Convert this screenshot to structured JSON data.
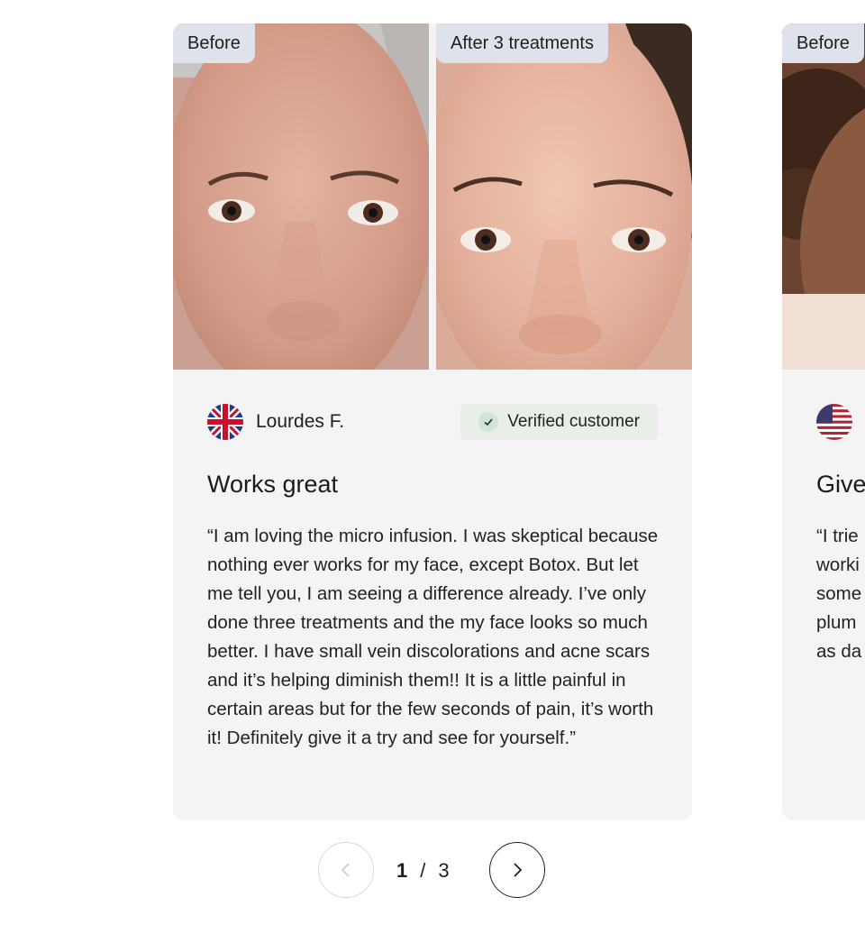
{
  "reviews": [
    {
      "before_label": "Before",
      "after_label": "After 3 treatments",
      "reviewer": "Lourdes F.",
      "country_flag": "uk-flag-icon",
      "verified_label": "Verified customer",
      "title": "Works great",
      "text": "“I am loving the micro infusion. I was skeptical because nothing ever works for my face, except Botox. But let me tell you, I am seeing a difference already. I’ve only done three treatments and the my face looks so much better. I have small vein discolorations and acne scars and it’s helping diminish them!! It is a little painful in certain areas but for the few seconds of pain, it’s worth it! Definitely give it a try and see for yourself.”"
    },
    {
      "before_label": "Before",
      "country_flag": "us-flag-icon",
      "title": "Give",
      "text_lines": [
        "“I trie",
        "worki",
        "some",
        "plum",
        "as da"
      ]
    }
  ],
  "pagination": {
    "current": "1",
    "separator": "/",
    "total": "3",
    "prev_icon": "chevron-left-icon",
    "next_icon": "chevron-right-icon"
  },
  "colors": {
    "card_bg": "#f4f4f4",
    "tag_bg": "#dfe2ea",
    "verified_bg": "#e9efe8",
    "check_bg": "#cfe3d8"
  }
}
